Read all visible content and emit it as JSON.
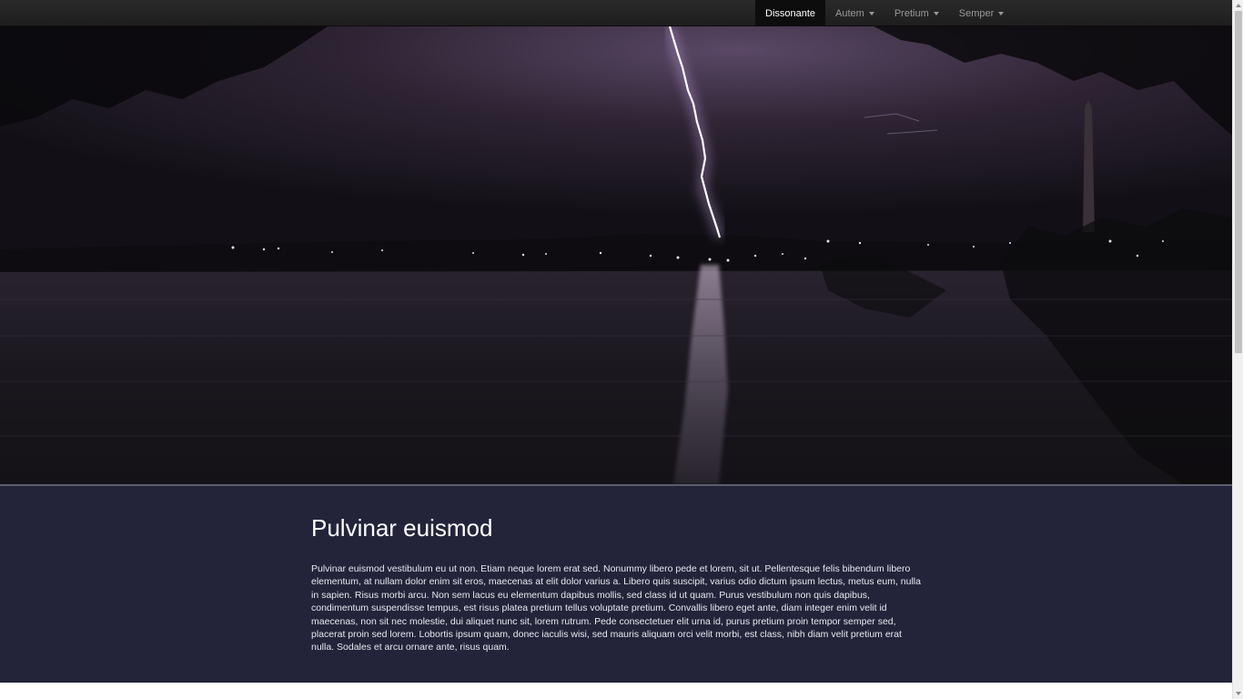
{
  "nav": {
    "items": [
      {
        "label": "Dissonante",
        "active": true,
        "dropdown": false
      },
      {
        "label": "Autem",
        "active": false,
        "dropdown": true
      },
      {
        "label": "Pretium",
        "active": false,
        "dropdown": true
      },
      {
        "label": "Semper",
        "active": false,
        "dropdown": true
      }
    ]
  },
  "hero": {
    "image": "night-lightning-over-lake-photo"
  },
  "content": {
    "heading": "Pulvinar euismod",
    "paragraph": "Pulvinar euismod vestibulum eu ut non. Etiam neque lorem erat sed. Nonummy libero pede et lorem, sit ut. Pellentesque felis bibendum libero elementum, at nullam dolor enim sit eros, maecenas at elit dolor varius a. Libero quis suscipit, varius odio dictum ipsum lectus, metus eum, nulla in sapien. Risus morbi arcu. Non sem lacus eu elementum dapibus mollis, sed class id ut quam. Purus vestibulum non quis dapibus, condimentum suspendisse tempus, est risus platea pretium tellus voluptate pretium. Convallis libero eget ante, diam integer enim velit id maecenas, non sit nec molestie, dui aliquet nunc sit, lorem rutrum. Pede consectetuer elit urna id, purus pretium proin tempor semper sed, placerat proin sed lorem. Lobortis ipsum quam, donec iaculis wisi, sed mauris aliquam orci velit morbi, est class, nibh diam velit pretium erat nulla. Sodales et arcu ornare ante, risus quam."
  },
  "colors": {
    "navbar": "#222222",
    "nav_active": "#0d0d0d",
    "content_band": "#23243a"
  }
}
